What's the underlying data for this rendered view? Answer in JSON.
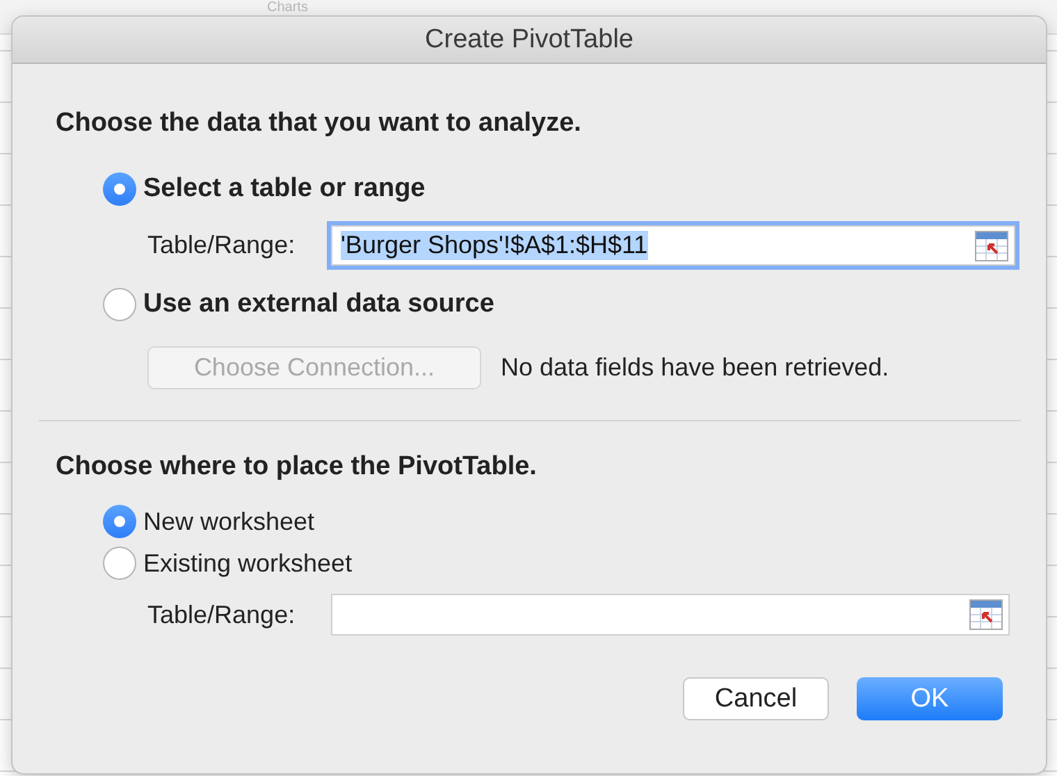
{
  "background": {
    "ribbon_label": "Charts"
  },
  "dialog": {
    "title": "Create PivotTable",
    "source_section": {
      "heading": "Choose the data that you want to analyze.",
      "options": [
        {
          "label": "Select a table or range",
          "selected": true
        },
        {
          "label": "Use an external data source",
          "selected": false
        }
      ],
      "range_field": {
        "label": "Table/Range:",
        "value": "'Burger Shops'!$A$1:$H$11",
        "focused": true
      },
      "connection_button": {
        "label": "Choose Connection...",
        "disabled": true
      },
      "connection_status": "No data fields have been retrieved."
    },
    "destination_section": {
      "heading": "Choose where to place the PivotTable.",
      "options": [
        {
          "label": "New worksheet",
          "selected": true
        },
        {
          "label": "Existing worksheet",
          "selected": false
        }
      ],
      "range_field": {
        "label": "Table/Range:",
        "focused": false
      }
    },
    "buttons": [
      {
        "label": "Cancel",
        "kind": "secondary"
      },
      {
        "label": "OK",
        "kind": "primary"
      }
    ]
  }
}
